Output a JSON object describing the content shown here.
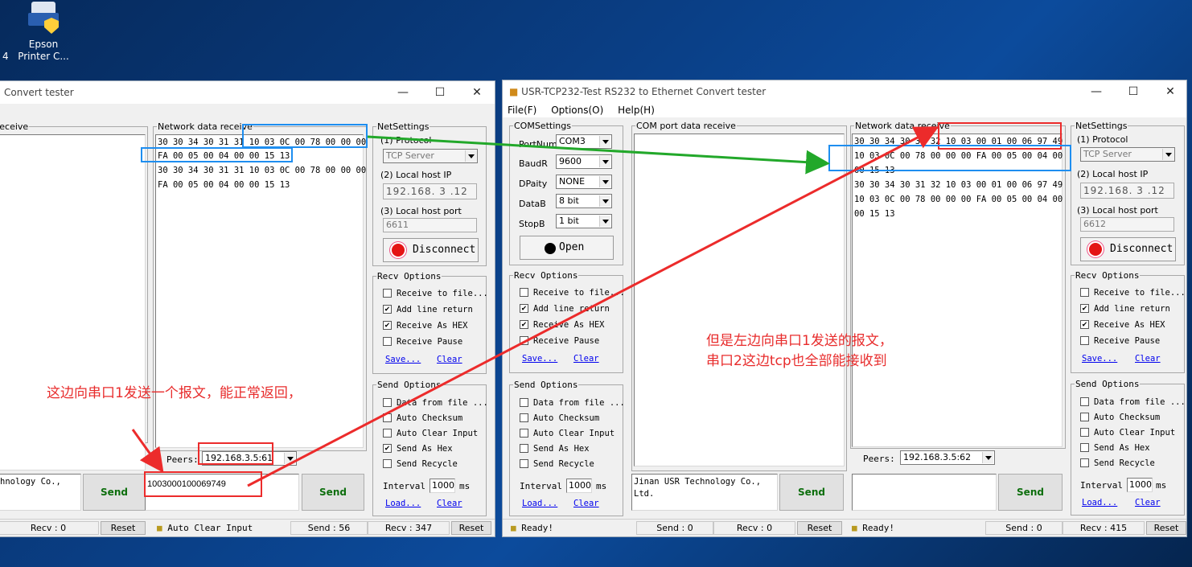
{
  "desktop": {
    "icon_label_1": "Epson",
    "icon_label_2": "Printer C...",
    "stray_digit": "4"
  },
  "left_window": {
    "title": "Convert tester",
    "left_group": "receive",
    "net_group": "Network data receive",
    "net_lines": [
      "30 30 34 30 31 31 10 03 0C 00 78 00 00 00",
      "FA 00 05 00 04 00 00 15 13",
      "30 30 34 30 31 31 10 03 0C 00 78 00 00 00",
      "FA 00 05 00 04 00 00 15 13"
    ],
    "send_text_left": "hnology Co.,",
    "send_text": "1003000100069749",
    "send_label": "Send",
    "peers_label": "Peers:",
    "peers_value": "192.168.3.5:61",
    "netsettings": {
      "title": "NetSettings",
      "protocol_label": "(1) Protocol",
      "protocol": "TCP Server",
      "ip_label": "(2) Local host IP",
      "ip": "192.168. 3 .12",
      "port_label": "(3) Local host port",
      "port": "6611",
      "disconnect": "Disconnect"
    },
    "recv_options": {
      "title": "Recv Options",
      "items": [
        "Receive to file...",
        "Add line return",
        "Receive As HEX",
        "Receive Pause"
      ],
      "checked": [
        false,
        true,
        true,
        false
      ],
      "save": "Save...",
      "clear": "Clear"
    },
    "send_options": {
      "title": "Send Options",
      "items": [
        "Data from file ...",
        "Auto Checksum",
        "Auto Clear Input",
        "Send As Hex",
        "Send Recycle"
      ],
      "checked": [
        false,
        false,
        false,
        true,
        false
      ],
      "interval_label": "Interval",
      "interval": "1000",
      "unit": "ms",
      "load": "Load...",
      "clear": "Clear"
    },
    "status": {
      "recv_left": "Recv : 0",
      "reset_left": "Reset",
      "status_text": "Auto Clear Input",
      "send": "Send : 56",
      "recv": "Recv : 347",
      "reset": "Reset"
    }
  },
  "right_window": {
    "title": "USR-TCP232-Test  RS232 to Ethernet Convert tester",
    "menu": [
      "File(F)",
      "Options(O)",
      "Help(H)"
    ],
    "com": {
      "title": "COMSettings",
      "port_label": "PortNum",
      "port": "COM3",
      "baud_label": "BaudR",
      "baud": "9600",
      "parity_label": "DPaity",
      "parity": "NONE",
      "data_label": "DataB",
      "data": "8 bit",
      "stop_label": "StopB",
      "stop": "1 bit",
      "open": "Open"
    },
    "com_recv_group": "COM port data receive",
    "net_group": "Network data receive",
    "net_lines": [
      "30 30 34 30 31 32 10 03 00 01 00 06 97 49",
      "10 03 0C 00 78 00 00 00 FA 00 05 00 04 00",
      "00 15 13",
      "30 30 34 30 31 32 10 03 00 01 00 06 97 49",
      "10 03 0C 00 78 00 00 00 FA 00 05 00 04 00",
      "00 15 13"
    ],
    "com_send_text": "Jinan USR Technology Co., Ltd.",
    "send_label": "Send",
    "peers_label": "Peers:",
    "peers_value": "192.168.3.5:62",
    "netsettings": {
      "title": "NetSettings",
      "protocol_label": "(1) Protocol",
      "protocol": "TCP Server",
      "ip_label": "(2) Local host IP",
      "ip": "192.168. 3 .12",
      "port_label": "(3) Local host port",
      "port": "6612",
      "disconnect": "Disconnect"
    },
    "recv_options_com": {
      "title": "Recv Options",
      "items": [
        "Receive to file...",
        "Add line return",
        "Receive As HEX",
        "Receive Pause"
      ],
      "checked": [
        false,
        true,
        true,
        false
      ],
      "save": "Save...",
      "clear": "Clear"
    },
    "send_options_com": {
      "title": "Send Options",
      "items": [
        "Data from file ...",
        "Auto Checksum",
        "Auto Clear Input",
        "Send As Hex",
        "Send Recycle"
      ],
      "checked": [
        false,
        false,
        false,
        false,
        false
      ],
      "interval_label": "Interval",
      "interval": "1000",
      "unit": "ms",
      "load": "Load...",
      "clear": "Clear"
    },
    "recv_options_net": {
      "title": "Recv Options",
      "items": [
        "Receive to file...",
        "Add line return",
        "Receive As HEX",
        "Receive Pause"
      ],
      "checked": [
        false,
        true,
        true,
        false
      ],
      "save": "Save...",
      "clear": "Clear"
    },
    "send_options_net": {
      "title": "Send Options",
      "items": [
        "Data from file ...",
        "Auto Checksum",
        "Auto Clear Input",
        "Send As Hex",
        "Send Recycle"
      ],
      "checked": [
        false,
        false,
        false,
        false,
        false
      ],
      "interval_label": "Interval",
      "interval": "1000",
      "unit": "ms",
      "load": "Load...",
      "clear": "Clear"
    },
    "status": {
      "ready_left": "Ready!",
      "send_com": "Send : 0",
      "recv_com": "Recv : 0",
      "reset_com": "Reset",
      "ready_right": "Ready!",
      "send_net": "Send : 0",
      "recv_net": "Recv : 415",
      "reset_net": "Reset"
    }
  },
  "annotations": {
    "left_note": "这边向串口1发送一个报文，能正常返回，",
    "right_note_1": "但是左边向串口1发送的报文，",
    "right_note_2": "串口2这边tcp也全部能接收到"
  },
  "colors": {
    "annotation_red": "#ec2b2b",
    "annotation_blue": "#1e8ef0",
    "annotation_green": "#22a82a",
    "send_green": "#0d6e0d"
  }
}
